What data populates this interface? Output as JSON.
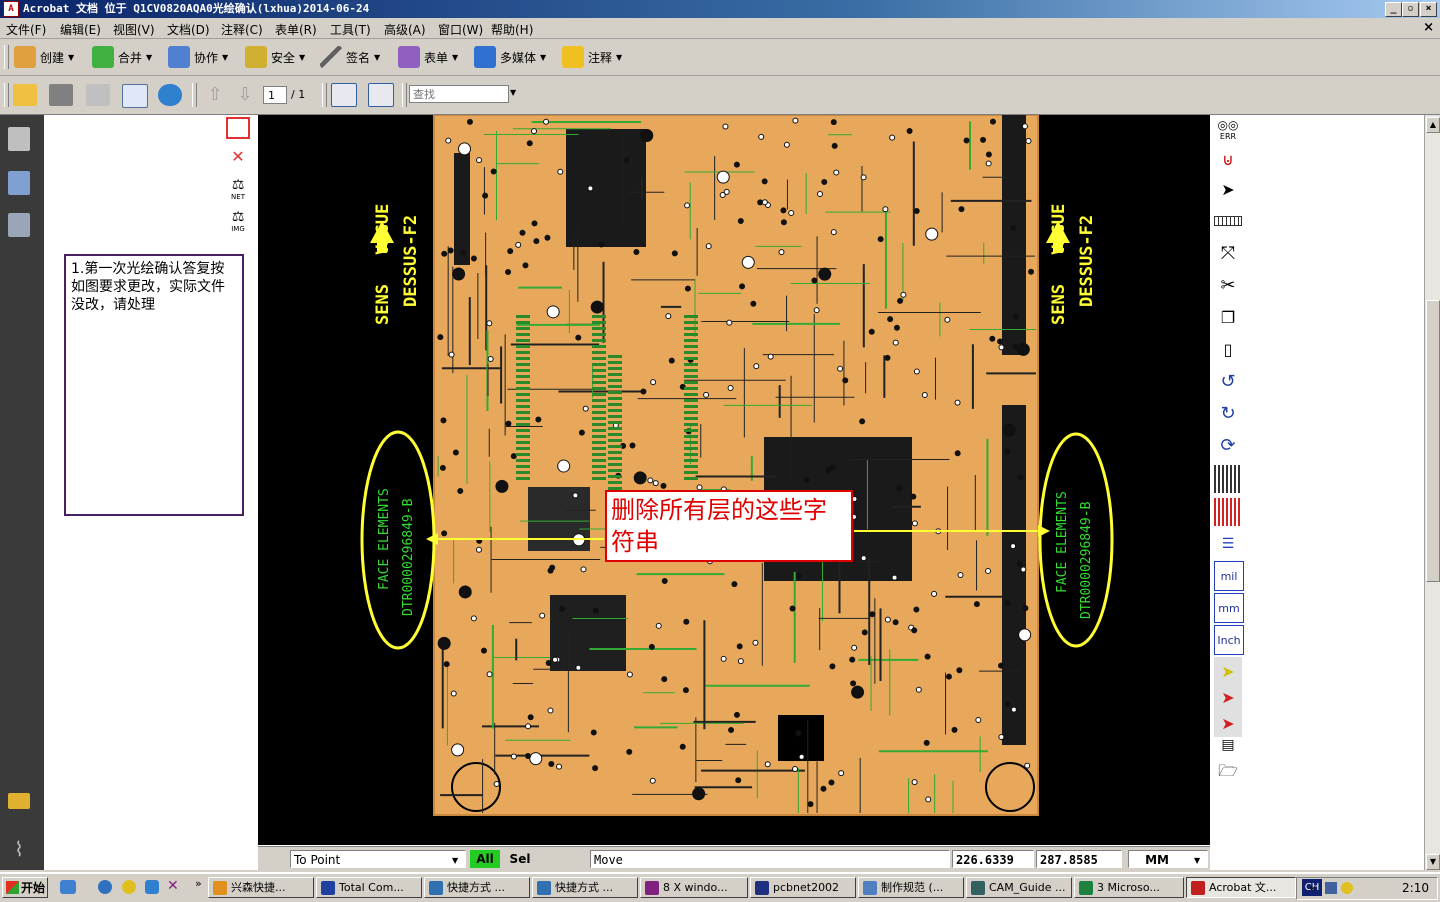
{
  "window": {
    "title": "Acrobat 文档 位于 Q1CV0820AQA0光绘确认(lxhua)2014-06-24",
    "app_icon": "pdf-icon"
  },
  "menubar": {
    "items": [
      "文件(F)",
      "编辑(E)",
      "视图(V)",
      "文档(D)",
      "注释(C)",
      "表单(R)",
      "工具(T)",
      "高级(A)",
      "窗口(W)",
      "帮助(H)"
    ],
    "close": "×"
  },
  "toolbar1": {
    "items": [
      {
        "label": "创建",
        "icon": "create-icon",
        "color": "#d08020"
      },
      {
        "label": "合并",
        "icon": "combine-icon",
        "color": "#30a030"
      },
      {
        "label": "协作",
        "icon": "collaborate-icon",
        "color": "#4070c0"
      },
      {
        "label": "安全",
        "icon": "lock-icon",
        "color": "#c0a020"
      },
      {
        "label": "签名",
        "icon": "pen-icon",
        "color": "#606060"
      },
      {
        "label": "表单",
        "icon": "form-icon",
        "color": "#8050c0"
      },
      {
        "label": "多媒体",
        "icon": "multimedia-icon",
        "color": "#2060c0"
      },
      {
        "label": "注释",
        "icon": "comment-icon",
        "color": "#e0a000"
      }
    ]
  },
  "toolbar2": {
    "page_current": "1",
    "page_total": "/ 1",
    "search_placeholder": "查找"
  },
  "note": {
    "text": "1.第一次光绘确认答复按如图要求更改，实际文件没改，请处理"
  },
  "annotation": {
    "text": "删除所有层的这些字符串"
  },
  "pcb": {
    "silk_left_1": "SENS",
    "silk_left_2": "VAGUE",
    "silk_left_3": "DESSUS-F2",
    "face_left_1": "FACE ELEMENTS",
    "face_left_2": "DTR0000296849-B",
    "silk_right_1": "SENS",
    "silk_right_2": "VAGUE",
    "silk_right_3": "DESSUS-F2",
    "face_right_1": "FACE ELEMENTS",
    "face_right_2": "DTR0000296849-B"
  },
  "left_tools": [
    {
      "icon": "list-icon",
      "label": ""
    },
    {
      "icon": "check-cross-icon",
      "label": ""
    },
    {
      "icon": "net-icon",
      "label": "NET"
    },
    {
      "icon": "img-icon",
      "label": "IMG"
    }
  ],
  "right_tools": [
    {
      "icon": "binoculars-icon",
      "label": "ERR"
    },
    {
      "icon": "magnet-icon",
      "label": ""
    },
    {
      "icon": "pointer-icon",
      "label": ""
    },
    {
      "icon": "ruler-icon",
      "label": ""
    },
    {
      "icon": "move-icon",
      "label": ""
    },
    {
      "icon": "scissors-icon",
      "label": ""
    },
    {
      "icon": "copy-icon",
      "label": ""
    },
    {
      "icon": "paste-icon",
      "label": ""
    },
    {
      "icon": "undo-icon",
      "label": ""
    },
    {
      "icon": "redo-icon",
      "label": ""
    },
    {
      "icon": "refresh-icon",
      "label": ""
    },
    {
      "icon": "grid-icon",
      "label": ""
    },
    {
      "icon": "grid-red-icon",
      "label": ""
    },
    {
      "icon": "layers-icon",
      "label": ""
    },
    {
      "icon": "unit-icon",
      "label": "mil"
    },
    {
      "icon": "unit-icon",
      "label": "mm"
    },
    {
      "icon": "unit-icon",
      "label": "Inch"
    },
    {
      "icon": "select-yellow-icon",
      "label": ""
    },
    {
      "icon": "select-red-icon",
      "label": ""
    },
    {
      "icon": "select-red2-icon",
      "label": ""
    },
    {
      "icon": "layer-list-icon",
      "label": ""
    },
    {
      "icon": "folder-open-icon",
      "label": ""
    }
  ],
  "pcb_status": {
    "snap": "To Point",
    "all": "All",
    "sel": "Sel",
    "mode": "Move",
    "x": "226.6339",
    "y": "287.8585",
    "unit": "MM"
  },
  "taskbar": {
    "start": "开始",
    "tasks": [
      "兴森快捷...",
      "Total Com...",
      "快捷方式 ...",
      "快捷方式 ...",
      "8 X windo...",
      "pcbnet2002",
      "制作规范 (...",
      "CAM_Guide ...",
      "3 Microso...",
      "Acrobat 文..."
    ],
    "lang": "CH",
    "clock": "2:10"
  },
  "colors": {
    "board": "#e8a85c",
    "silk_yellow": "#ffff33",
    "silk_green": "#33dd33",
    "annotation_red": "#e00000",
    "note_border": "#4a2060"
  }
}
